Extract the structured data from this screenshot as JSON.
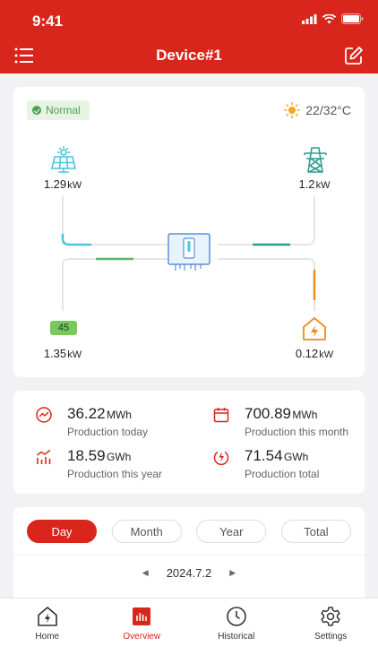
{
  "status_bar": {
    "time": "9:41"
  },
  "header": {
    "title": "Device#1"
  },
  "flow": {
    "status": "Normal",
    "weather": "22/32°C",
    "solar": {
      "value": "1.29",
      "unit": "kW"
    },
    "grid": {
      "value": "1.2",
      "unit": "kW"
    },
    "battery": {
      "level": "45",
      "value": "1.35",
      "unit": "kW"
    },
    "home": {
      "value": "0.12",
      "unit": "kW"
    }
  },
  "stats": [
    {
      "value": "36.22",
      "unit": "MWh",
      "label": "Production today",
      "icon": "trend-icon"
    },
    {
      "value": "700.89",
      "unit": "MWh",
      "label": "Production this month",
      "icon": "calendar-icon"
    },
    {
      "value": "18.59",
      "unit": "GWh",
      "label": "Production this year",
      "icon": "bar-chart-icon"
    },
    {
      "value": "71.54",
      "unit": "GWh",
      "label": "Production total",
      "icon": "power-icon"
    }
  ],
  "chart_tabs": [
    "Day",
    "Month",
    "Year",
    "Total"
  ],
  "chart_date": "2024.7.2",
  "tabbar": [
    {
      "label": "Home",
      "icon": "home-bolt-icon"
    },
    {
      "label": "Overview",
      "icon": "overview-chart-icon"
    },
    {
      "label": "Historical",
      "icon": "clock-icon"
    },
    {
      "label": "Settings",
      "icon": "gear-icon"
    }
  ],
  "colors": {
    "brand": "#d9261c",
    "ok": "#4aa24a",
    "solar": "#4cc3e0",
    "grid": "#2f9c8c",
    "home": "#f08a1c"
  }
}
